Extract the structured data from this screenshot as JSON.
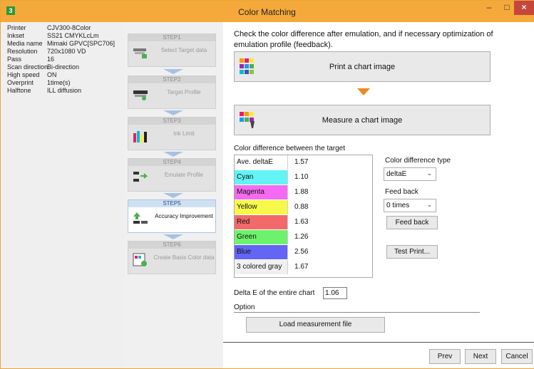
{
  "window": {
    "title": "Color Matching",
    "icon_text": "3",
    "minimize": "–",
    "maximize": "□",
    "close": "×"
  },
  "printer_info": [
    {
      "key": "Printer",
      "value": "CJV300-8Color"
    },
    {
      "key": "Inkset",
      "value": "SS21 CMYKLcLm"
    },
    {
      "key": "Media name",
      "value": "Mimaki GPVC[SPC706]"
    },
    {
      "key": "Resolution",
      "value": "720x1080 VD"
    },
    {
      "key": "Pass",
      "value": "16"
    },
    {
      "key": "Scan direction",
      "value": "Bi-direction"
    },
    {
      "key": "High speed",
      "value": "ON"
    },
    {
      "key": "Overprint",
      "value": "1time(s)"
    },
    {
      "key": "Halftone",
      "value": "ILL diffusion"
    }
  ],
  "steps": [
    {
      "header": "STEP1",
      "label": "Select Target data"
    },
    {
      "header": "STEP2",
      "label": "Target Profile"
    },
    {
      "header": "STEP3",
      "label": "Ink Limit"
    },
    {
      "header": "STEP4",
      "label": "Emulate Profile"
    },
    {
      "header": "STEP5",
      "label": "Accuracy Improvement"
    },
    {
      "header": "STEP6",
      "label": "Create Basis Color data"
    }
  ],
  "main": {
    "instruction": "Check the color difference after emulation, and if necessary optimization of emulation profile (feedback).",
    "print_chart_label": "Print a chart image",
    "measure_chart_label": "Measure a chart image",
    "color_diff_label": "Color difference between the target",
    "rows": [
      {
        "name": "Ave. deltaE",
        "value": "1.57",
        "color": "#ffffff"
      },
      {
        "name": "Cyan",
        "value": "1.10",
        "color": "#63f3f5"
      },
      {
        "name": "Magenta",
        "value": "1.88",
        "color": "#f56af0"
      },
      {
        "name": "Yellow",
        "value": "0.88",
        "color": "#f7f94a"
      },
      {
        "name": "Red",
        "value": "1.63",
        "color": "#f26969"
      },
      {
        "name": "Green",
        "value": "1.26",
        "color": "#6ef26c"
      },
      {
        "name": "Blue",
        "value": "2.56",
        "color": "#6464f5"
      },
      {
        "name": "3 colored gray",
        "value": "1.67",
        "color": "#f0f0f0"
      }
    ],
    "diff_type_label": "Color difference type",
    "diff_type_value": "deltaE",
    "feedback_label": "Feed back",
    "feedback_value": "0 times",
    "feedback_button": "Feed back",
    "test_print_button": "Test Print...",
    "delta_entire_label": "Delta E of the entire chart",
    "delta_entire_value": "1.06",
    "option_label": "Option",
    "load_button": "Load measurement file"
  },
  "footer": {
    "prev": "Prev",
    "next": "Next",
    "cancel": "Cancel"
  }
}
